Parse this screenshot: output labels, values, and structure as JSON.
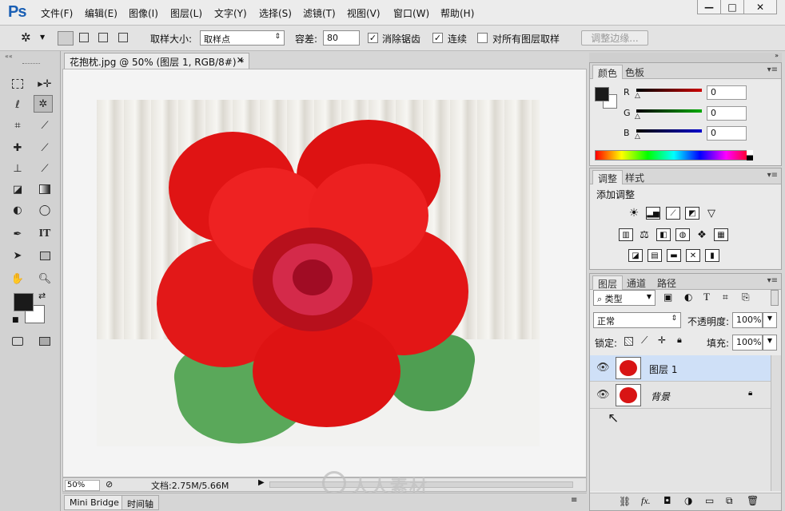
{
  "app": {
    "logo": "Ps"
  },
  "menu": [
    "文件(F)",
    "编辑(E)",
    "图像(I)",
    "图层(L)",
    "文字(Y)",
    "选择(S)",
    "滤镜(T)",
    "视图(V)",
    "窗口(W)",
    "帮助(H)"
  ],
  "window_buttons": {
    "minimize": "—",
    "maximize": "□",
    "close": "✕"
  },
  "options": {
    "sample_size_label": "取样大小:",
    "sample_size_value": "取样点",
    "tolerance_label": "容差:",
    "tolerance_value": "80",
    "anti_alias": {
      "label": "消除锯齿",
      "checked": true
    },
    "contiguous": {
      "label": "连续",
      "checked": true
    },
    "all_layers": {
      "label": "对所有图层取样",
      "checked": false
    },
    "refine_edge": "调整边缘..."
  },
  "document": {
    "tab_title": "花抱枕.jpg @ 50% (图层 1, RGB/8#) *",
    "zoom": "50%",
    "doc_info": "文档:2.75M/5.66M"
  },
  "bottom_tabs": [
    "Mini Bridge",
    "时间轴"
  ],
  "color_panel": {
    "tabs": [
      "颜色",
      "色板"
    ],
    "channels": [
      {
        "label": "R",
        "value": "0",
        "color": "#cc0000"
      },
      {
        "label": "G",
        "value": "0",
        "color": "#00aa00"
      },
      {
        "label": "B",
        "value": "0",
        "color": "#0000cc"
      }
    ]
  },
  "adjust_panel": {
    "tabs": [
      "调整",
      "样式"
    ],
    "heading": "添加调整"
  },
  "layers_panel": {
    "tabs": [
      "图层",
      "通道",
      "路径"
    ],
    "filter_label": "类型",
    "blend_mode": "正常",
    "opacity_label": "不透明度:",
    "opacity_value": "100%",
    "lock_label": "锁定:",
    "fill_label": "填充:",
    "fill_value": "100%",
    "layers": [
      {
        "name": "图层 1",
        "selected": true
      },
      {
        "name": "背景",
        "selected": false,
        "locked": true
      }
    ]
  },
  "watermark": "人人素材",
  "colors": {
    "foreground": "#1a1a1a",
    "background": "#ffffff",
    "accent": "#1a5fb4",
    "selection": "#cfe0f7"
  }
}
